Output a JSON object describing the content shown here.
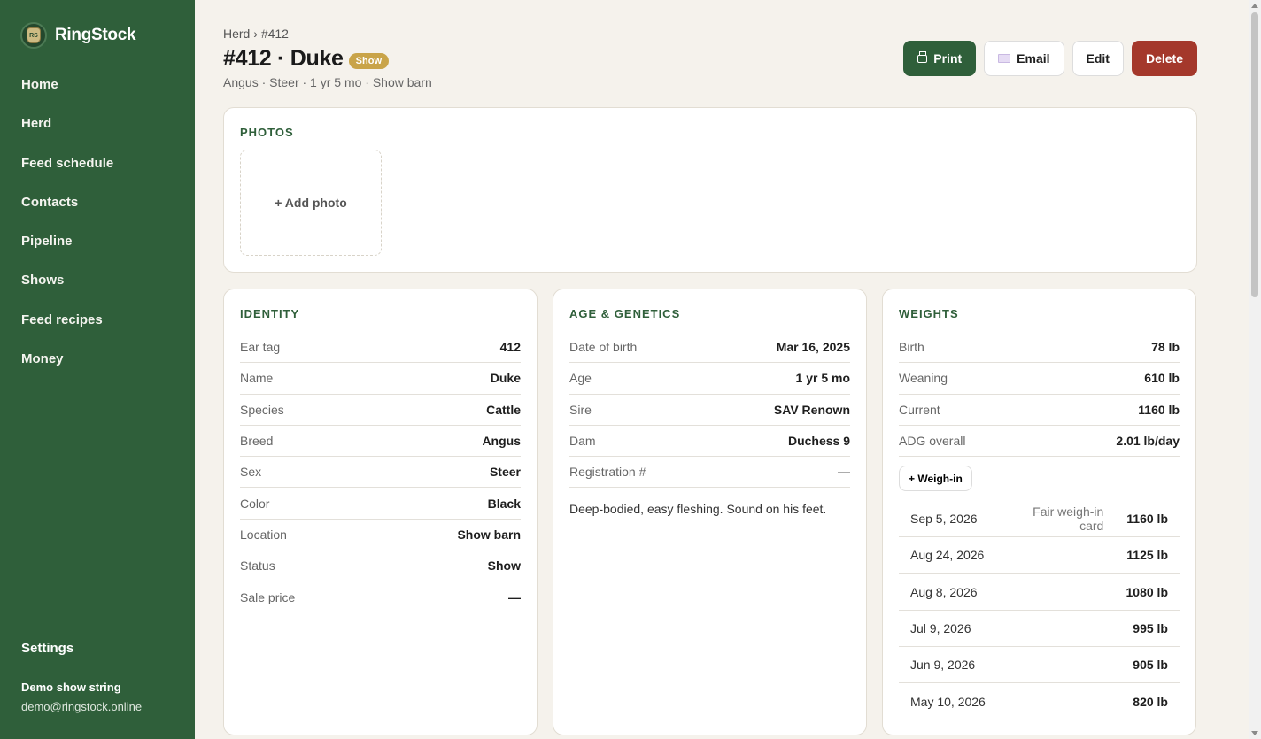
{
  "app": {
    "name": "RingStock",
    "logo_text": "RS"
  },
  "sidebar": {
    "items": [
      {
        "label": "Home"
      },
      {
        "label": "Herd"
      },
      {
        "label": "Feed schedule"
      },
      {
        "label": "Contacts"
      },
      {
        "label": "Pipeline"
      },
      {
        "label": "Shows"
      },
      {
        "label": "Feed recipes"
      },
      {
        "label": "Money"
      }
    ],
    "settings_label": "Settings",
    "account_name": "Demo show string",
    "account_email": "demo@ringstock.online"
  },
  "header": {
    "breadcrumb_parent": "Herd",
    "breadcrumb_sep": "›",
    "breadcrumb_current": "#412",
    "title": "#412 · Duke",
    "badge": "Show",
    "subtitle": "Angus · Steer · 1 yr 5 mo · Show barn"
  },
  "actions": {
    "print": "Print",
    "email": "Email",
    "edit": "Edit",
    "delete": "Delete"
  },
  "photos": {
    "title": "PHOTOS",
    "add_label": "+ Add photo"
  },
  "identity": {
    "title": "IDENTITY",
    "rows": [
      {
        "k": "Ear tag",
        "v": "412"
      },
      {
        "k": "Name",
        "v": "Duke"
      },
      {
        "k": "Species",
        "v": "Cattle"
      },
      {
        "k": "Breed",
        "v": "Angus"
      },
      {
        "k": "Sex",
        "v": "Steer"
      },
      {
        "k": "Color",
        "v": "Black"
      },
      {
        "k": "Location",
        "v": "Show barn"
      },
      {
        "k": "Status",
        "v": "Show"
      },
      {
        "k": "Sale price",
        "v": "—"
      }
    ]
  },
  "genetics": {
    "title": "AGE & GENETICS",
    "rows": [
      {
        "k": "Date of birth",
        "v": "Mar 16, 2025"
      },
      {
        "k": "Age",
        "v": "1 yr 5 mo"
      },
      {
        "k": "Sire",
        "v": "SAV Renown"
      },
      {
        "k": "Dam",
        "v": "Duchess 9"
      },
      {
        "k": "Registration #",
        "v": "—"
      }
    ],
    "notes": "Deep-bodied, easy fleshing. Sound on his feet."
  },
  "weights": {
    "title": "WEIGHTS",
    "rows": [
      {
        "k": "Birth",
        "v": "78 lb"
      },
      {
        "k": "Weaning",
        "v": "610 lb"
      },
      {
        "k": "Current",
        "v": "1160 lb"
      },
      {
        "k": "ADG overall",
        "v": "2.01 lb/day"
      }
    ],
    "weighin_label": "+ Weigh-in",
    "history": [
      {
        "date": "Sep 5, 2026",
        "note": "Fair weigh-in card",
        "weight": "1160 lb"
      },
      {
        "date": "Aug 24, 2026",
        "note": "",
        "weight": "1125 lb"
      },
      {
        "date": "Aug 8, 2026",
        "note": "",
        "weight": "1080 lb"
      },
      {
        "date": "Jul 9, 2026",
        "note": "",
        "weight": "995 lb"
      },
      {
        "date": "Jun 9, 2026",
        "note": "",
        "weight": "905 lb"
      },
      {
        "date": "May 10, 2026",
        "note": "",
        "weight": "820 lb"
      }
    ]
  },
  "colors": {
    "sidebar_bg": "#2f5f3a",
    "accent": "#2f5f3a",
    "badge": "#c9a449",
    "danger": "#a4382b",
    "page_bg": "#f5f2ec"
  }
}
